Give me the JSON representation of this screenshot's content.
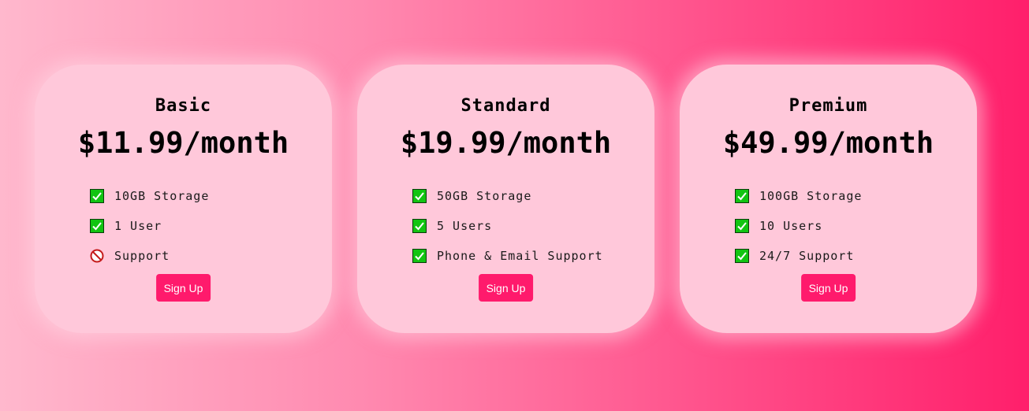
{
  "plans": [
    {
      "title": "Basic",
      "price": "$11.99/month",
      "features": [
        {
          "text": "10GB Storage",
          "icon": "checkmark-icon"
        },
        {
          "text": "1 User",
          "icon": "checkmark-icon"
        },
        {
          "text": "Support",
          "icon": "prohibited-icon"
        }
      ],
      "button": "Sign Up"
    },
    {
      "title": "Standard",
      "price": "$19.99/month",
      "features": [
        {
          "text": "50GB Storage",
          "icon": "checkmark-icon"
        },
        {
          "text": "5 Users",
          "icon": "checkmark-icon"
        },
        {
          "text": "Phone & Email Support",
          "icon": "checkmark-icon"
        }
      ],
      "button": "Sign Up"
    },
    {
      "title": "Premium",
      "price": "$49.99/month",
      "features": [
        {
          "text": "100GB Storage",
          "icon": "checkmark-icon"
        },
        {
          "text": "10 Users",
          "icon": "checkmark-icon"
        },
        {
          "text": "24/7 Support",
          "icon": "checkmark-icon"
        }
      ],
      "button": "Sign Up"
    }
  ],
  "colors": {
    "card_background": "#ffc8da",
    "button_background": "#ff1a6c",
    "check_green": "#12c412",
    "prohibited_red": "#c41a1a"
  }
}
